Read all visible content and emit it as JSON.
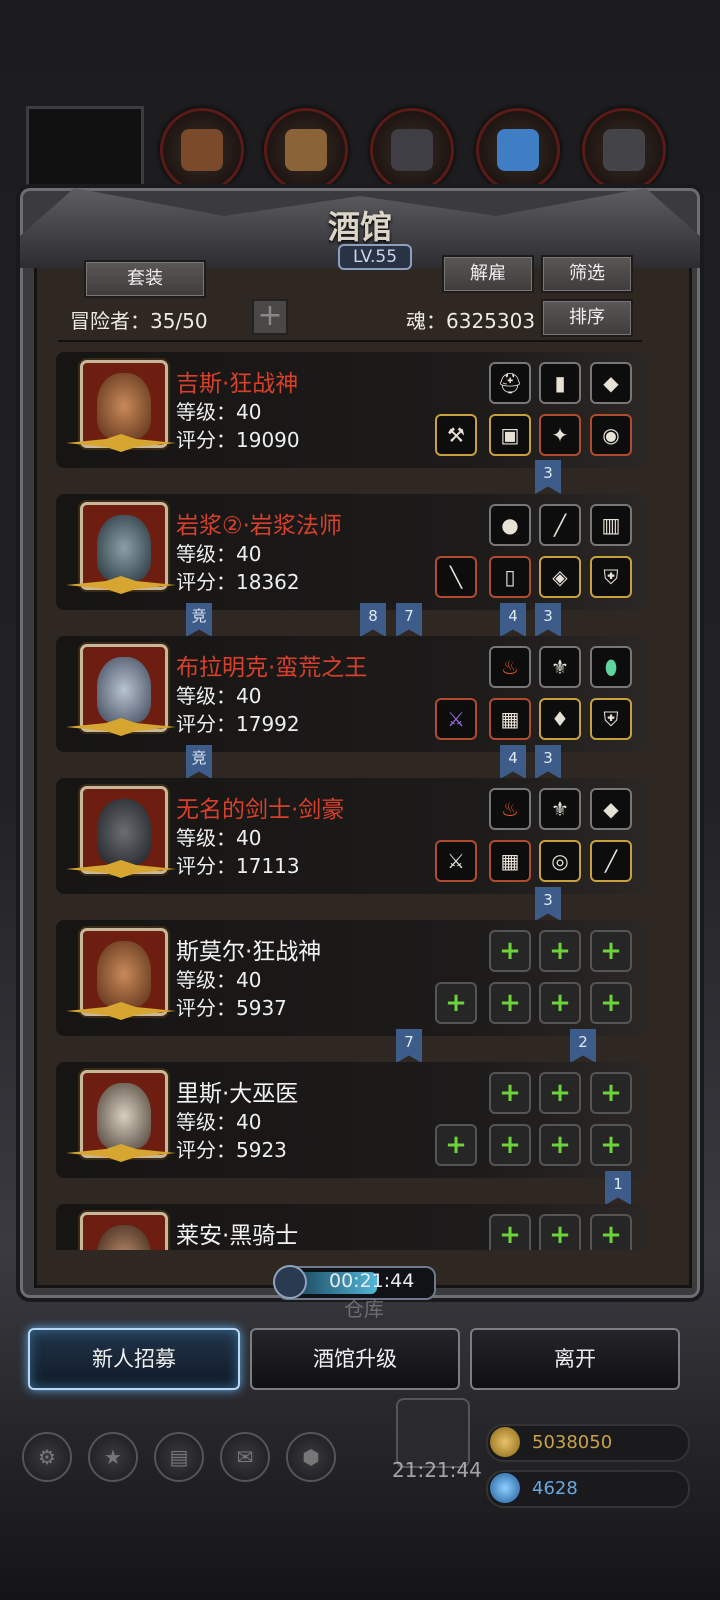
{
  "panel": {
    "title": "酒馆",
    "level": "LV.55",
    "suit_button": "套装",
    "dismiss_button": "解雇",
    "filter_button": "筛选",
    "sort_button": "排序",
    "adventurers_label": "冒险者：35/50",
    "soul_label": "魂：6325303"
  },
  "heroes": [
    {
      "name": "吉斯·狂战神",
      "level": "等级：40",
      "score": "评分：19090",
      "name_color": "#d9402b"
    },
    {
      "name": "岩浆②·岩浆法师",
      "level": "等级：40",
      "score": "评分：18362",
      "name_color": "#d9402b"
    },
    {
      "name": "布拉明克·蛮荒之王",
      "level": "等级：40",
      "score": "评分：17992",
      "name_color": "#d9402b"
    },
    {
      "name": "无名的剑士·剑豪",
      "level": "等级：40",
      "score": "评分：17113",
      "name_color": "#d9402b"
    },
    {
      "name": "斯莫尔·狂战神",
      "level": "等级：40",
      "score": "评分：5937",
      "name_color": "#f2f2f2"
    },
    {
      "name": "里斯·大巫医",
      "level": "等级：40",
      "score": "评分：5923",
      "name_color": "#f2f2f2"
    },
    {
      "name": "莱安·黑骑士",
      "level": "",
      "score": "",
      "name_color": "#f2f2f2"
    }
  ],
  "tags": {
    "compete": "竞",
    "n1": "1",
    "n2": "2",
    "n3": "3",
    "n4": "4",
    "n7": "7",
    "n8": "8"
  },
  "bottom": {
    "timer": "00:21:44",
    "recruit_button": "新人招募",
    "upgrade_button": "酒馆升级",
    "leave_button": "离开",
    "warehouse_ghost": "仓库",
    "gift_timer": "21:21:44",
    "gold": "5038050",
    "gems": "4628"
  },
  "colors": {
    "accent_blue": "#5fa8e8",
    "legend_red": "#d9402b",
    "plus_green": "#6dd33b"
  }
}
